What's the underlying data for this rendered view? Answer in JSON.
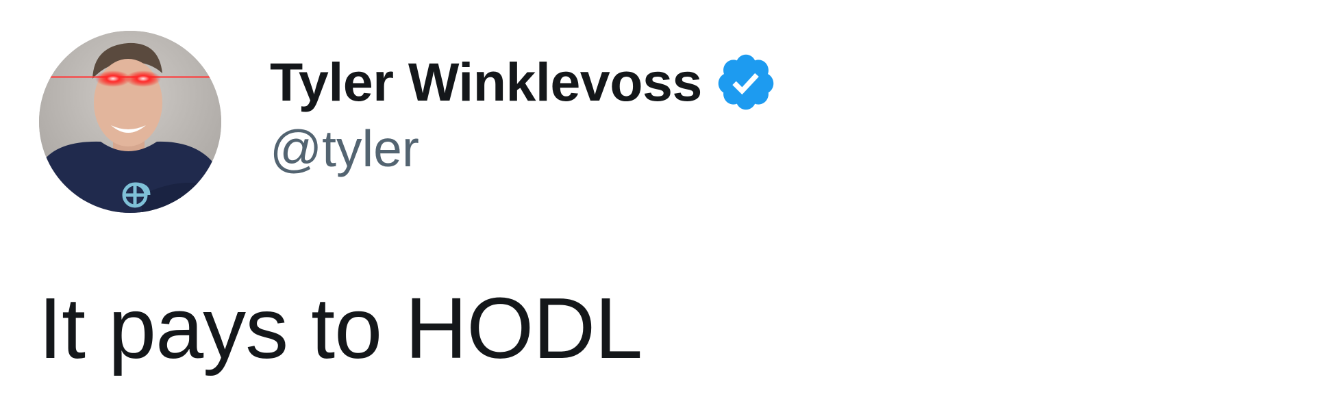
{
  "author": {
    "display_name": "Tyler Winklevoss",
    "handle": "@tyler",
    "verified": true,
    "verified_icon": "verified-badge-icon",
    "avatar_icon": "profile-photo"
  },
  "tweet": {
    "text": "It pays to HODL"
  },
  "colors": {
    "text_primary": "#14171a",
    "text_secondary": "#536471",
    "verified_blue": "#1d9bf0",
    "background": "#ffffff"
  }
}
